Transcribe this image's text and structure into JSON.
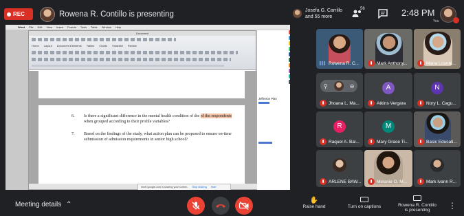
{
  "recording": {
    "label": "REC"
  },
  "top_bar": {
    "presenting_text": "Rowena R. Contillo is presenting",
    "participant_summary": [
      "Josefa G. Carrillo",
      "and 55 more"
    ],
    "people_count": "56",
    "clock": "2:48 PM",
    "self_label": "You"
  },
  "shared_screen": {
    "mac_menu": [
      "Word",
      "File",
      "Edit",
      "View",
      "Insert",
      "Format",
      "Tools",
      "Table",
      "Window",
      "Help"
    ],
    "ribbon_tabs": [
      "Home",
      "Layout",
      "Document Elements",
      "Tables",
      "Charts",
      "SmartArt",
      "Review"
    ],
    "window_title": "Document",
    "items": [
      {
        "number": "6.",
        "before": "Is there a significant difference in the mental health condition of the respondents ",
        "highlight": "of the respondents",
        "after": " when grouped according to their profile variables?"
      },
      {
        "number": "7.",
        "before": "Based on the findings of the study, what action plan can be proposed to ensure on-time submission of admission requirements in senior high school?",
        "highlight": "",
        "after": ""
      }
    ],
    "share_banner": {
      "text": "meet.google.com is sharing your screen.",
      "stop": "Stop sharing",
      "hide": "Hide"
    },
    "side_texts": [
      "Jefferson Plan"
    ]
  },
  "participants": [
    {
      "name": "Rowena R. C...",
      "type": "video",
      "speaking": true
    },
    {
      "name": "Mark Anthony...",
      "type": "video"
    },
    {
      "name": "Maria Lourde...",
      "type": "video"
    },
    {
      "name": "Jhoana L. Ma...",
      "type": "self"
    },
    {
      "name": "Atkins Vergara",
      "type": "initial",
      "initial": "A",
      "color": "#7e57c2"
    },
    {
      "name": "Nory L. Cagu...",
      "type": "initial",
      "initial": "N",
      "color": "#5e35b1"
    },
    {
      "name": "Raquel A. Bal...",
      "type": "initial",
      "initial": "R",
      "color": "#e91e63"
    },
    {
      "name": "Mary Grace Ti...",
      "type": "initial",
      "initial": "M",
      "color": "#00897b"
    },
    {
      "name": "Basic Educati...",
      "type": "video"
    },
    {
      "name": "ARLENE BAW...",
      "type": "photo"
    },
    {
      "name": "Melanie O. M...",
      "type": "video"
    },
    {
      "name": "Mark Ivann R...",
      "type": "photo"
    }
  ],
  "toolbar": {
    "meeting_details": "Meeting details",
    "raise_hand": "Raise hand",
    "captions": "Turn on captions",
    "presenting": [
      "Rowena R. Contillo",
      "is presenting"
    ]
  },
  "colors": {
    "bg": "#202124",
    "tile": "#3c4043",
    "danger": "#ea4335",
    "accent": "#8ab4f8"
  }
}
